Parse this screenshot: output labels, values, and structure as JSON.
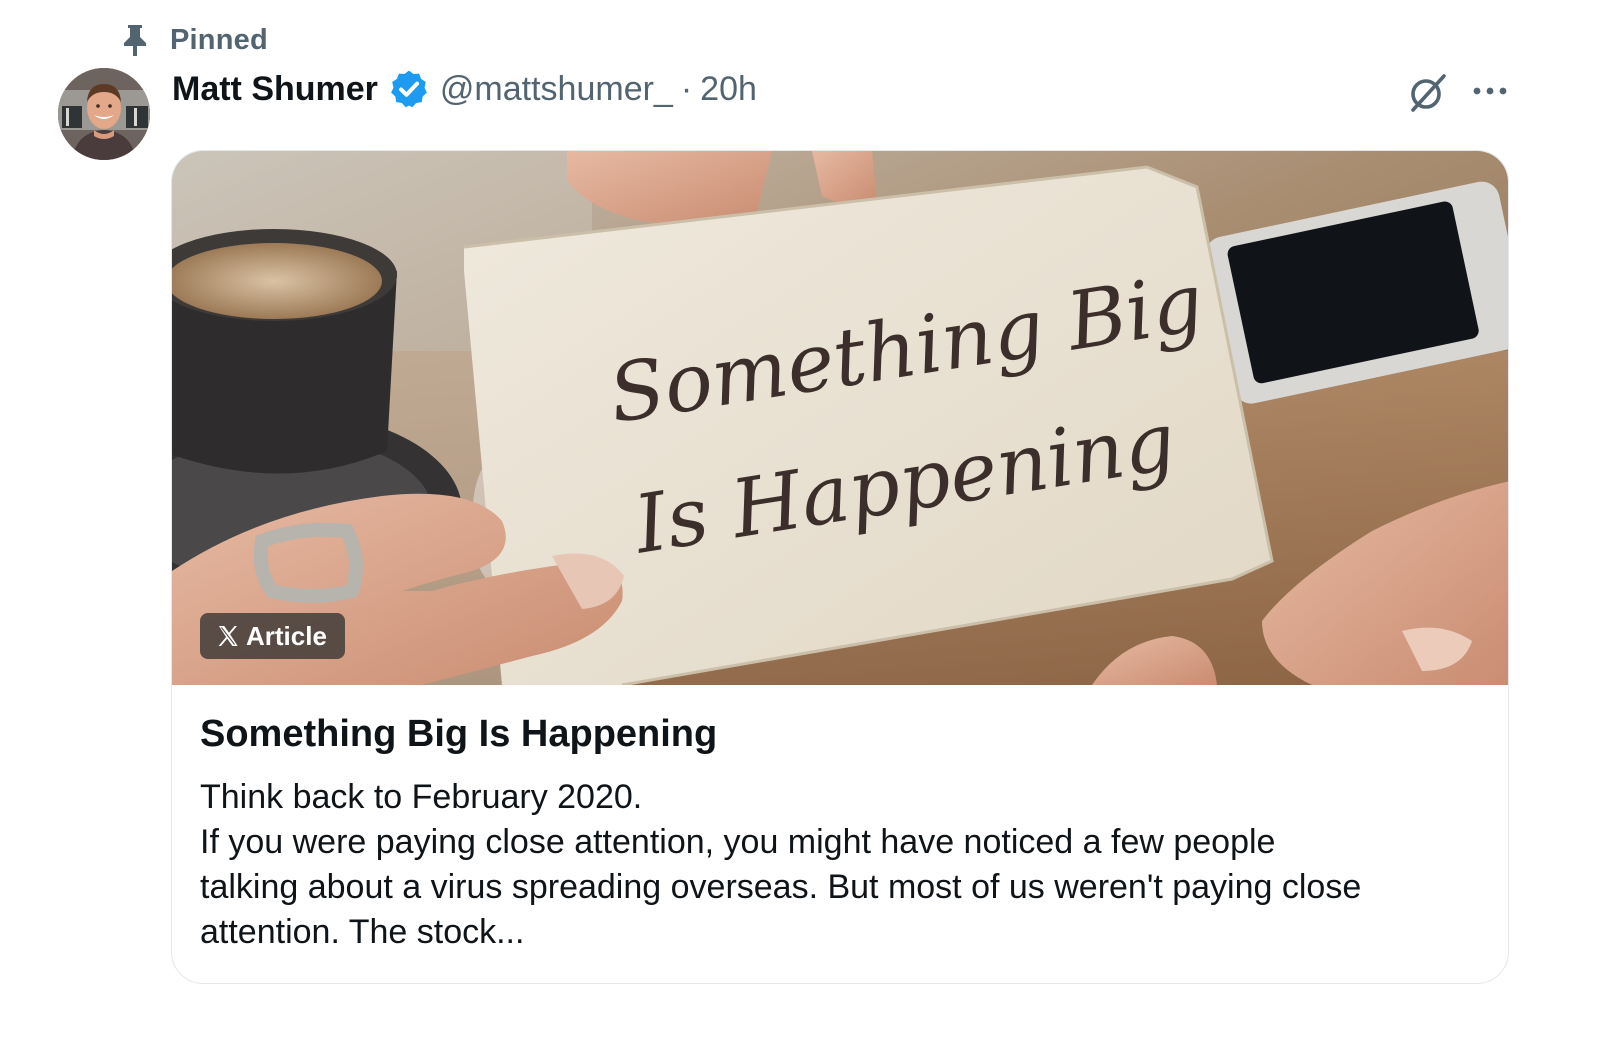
{
  "pinned": {
    "label": "Pinned",
    "icon": "pin-icon"
  },
  "author": {
    "display_name": "Matt Shumer",
    "verified": true,
    "verified_color": "#1d9bf0",
    "handle": "@mattshumer_",
    "separator": "·",
    "time": "20h"
  },
  "actions": {
    "grok_icon": "grok-icon",
    "more_icon": "more-icon"
  },
  "article": {
    "badge_label": "Article",
    "badge_icon": "x-logo-icon",
    "image_text_line1": "Something Big",
    "image_text_line2": "Is Happening",
    "title": "Something Big Is Happening",
    "excerpt_lines": [
      "Think back to February 2020.",
      "If you were paying close attention, you might have noticed a few people",
      "talking about a virus spreading overseas. But most of us weren't paying close",
      "attention. The stock..."
    ]
  },
  "colors": {
    "text_primary": "#0f1419",
    "text_secondary": "#536471",
    "card_border": "#e4e8eb"
  }
}
